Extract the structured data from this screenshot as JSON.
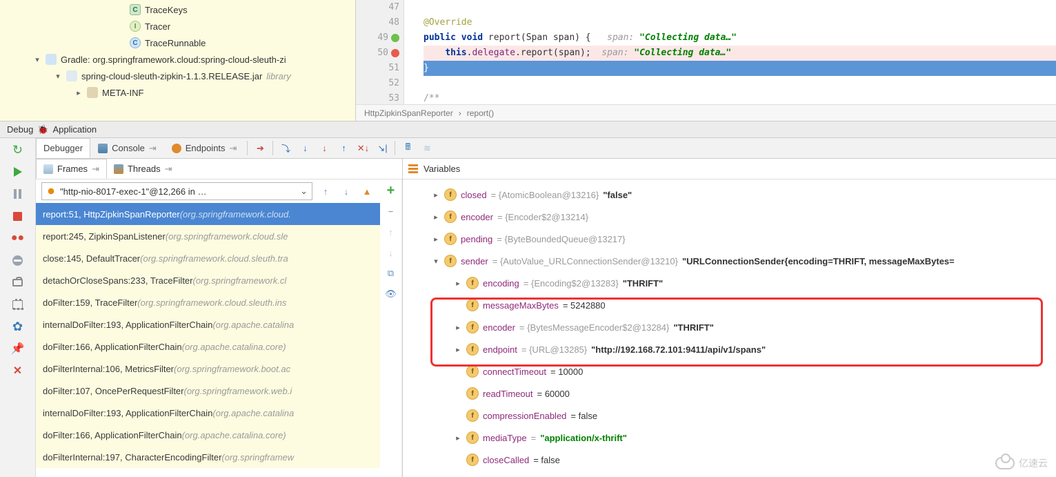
{
  "projectTree": {
    "items": [
      {
        "indent": 170,
        "exp": "",
        "icon": "ico-key",
        "iconChar": "C",
        "label": "TraceKeys"
      },
      {
        "indent": 170,
        "exp": "",
        "icon": "ico-i",
        "iconChar": "I",
        "label": "Tracer"
      },
      {
        "indent": 170,
        "exp": "",
        "icon": "ico-c",
        "iconChar": "C",
        "label": "TraceRunnable"
      },
      {
        "indent": 48,
        "exp": "▾",
        "icon": "ico-gradle",
        "iconChar": "",
        "label": "Gradle: org.springframework.cloud:spring-cloud-sleuth-zi"
      },
      {
        "indent": 78,
        "exp": "▾",
        "icon": "ico-jar",
        "iconChar": "",
        "label": "spring-cloud-sleuth-zipkin-1.1.3.RELEASE.jar",
        "suffix": "library"
      },
      {
        "indent": 108,
        "exp": "▸",
        "icon": "ico-folder",
        "iconChar": "",
        "label": "META-INF"
      }
    ]
  },
  "editor": {
    "lines": [
      {
        "num": "47",
        "gutter": "",
        "segments": []
      },
      {
        "num": "48",
        "gutter": "",
        "segments": [
          {
            "cls": "kw-ann",
            "t": "@Override"
          }
        ]
      },
      {
        "num": "49",
        "gutter": "green",
        "segments": [
          {
            "cls": "kw",
            "t": "public void "
          },
          {
            "cls": "fn",
            "t": "report"
          },
          {
            "cls": "",
            "t": "(Span span) { "
          },
          {
            "cls": "prm",
            "t": "  span: "
          },
          {
            "cls": "str",
            "t": "\"Collecting data…\""
          }
        ]
      },
      {
        "num": "50",
        "gutter": "red",
        "hl": true,
        "segments": [
          {
            "cls": "",
            "t": "    "
          },
          {
            "cls": "kw-this",
            "t": "this"
          },
          {
            "cls": "",
            "t": "."
          },
          {
            "cls": "mem",
            "t": "delegate"
          },
          {
            "cls": "",
            "t": ".report(span);"
          },
          {
            "cls": "prm",
            "t": "  span: "
          },
          {
            "cls": "str",
            "t": "\"Collecting data…\""
          }
        ]
      },
      {
        "num": "51",
        "gutter": "",
        "sel": true,
        "segments": [
          {
            "cls": "",
            "t": "}"
          }
        ]
      },
      {
        "num": "52",
        "gutter": "",
        "segments": []
      },
      {
        "num": "53",
        "gutter": "",
        "segments": [
          {
            "cls": "cmt",
            "t": "/**"
          }
        ]
      }
    ],
    "breadcrumb": [
      "HttpZipkinSpanReporter",
      "report()"
    ]
  },
  "debugBar": {
    "label": "Debug",
    "app": "Application"
  },
  "tabs": {
    "debugger": "Debugger",
    "console": "Console",
    "endpoints": "Endpoints"
  },
  "framesPanel": {
    "frames": "Frames",
    "threads": "Threads",
    "thread": "\"http-nio-8017-exec-1\"@12,266 in …",
    "stack": [
      {
        "sel": true,
        "lib": false,
        "main": "report:51, HttpZipkinSpanReporter ",
        "gray": "(org.springframework.cloud."
      },
      {
        "sel": false,
        "lib": true,
        "main": "report:245, ZipkinSpanListener ",
        "gray": "(org.springframework.cloud.sle"
      },
      {
        "sel": false,
        "lib": true,
        "main": "close:145, DefaultTracer ",
        "gray": "(org.springframework.cloud.sleuth.tra"
      },
      {
        "sel": false,
        "lib": true,
        "main": "detachOrCloseSpans:233, TraceFilter ",
        "gray": "(org.springframework.cl"
      },
      {
        "sel": false,
        "lib": true,
        "main": "doFilter:159, TraceFilter ",
        "gray": "(org.springframework.cloud.sleuth.ins"
      },
      {
        "sel": false,
        "lib": true,
        "main": "internalDoFilter:193, ApplicationFilterChain ",
        "gray": "(org.apache.catalina"
      },
      {
        "sel": false,
        "lib": true,
        "main": "doFilter:166, ApplicationFilterChain ",
        "gray": "(org.apache.catalina.core)"
      },
      {
        "sel": false,
        "lib": true,
        "main": "doFilterInternal:106, MetricsFilter ",
        "gray": "(org.springframework.boot.ac"
      },
      {
        "sel": false,
        "lib": true,
        "main": "doFilter:107, OncePerRequestFilter ",
        "gray": "(org.springframework.web.i"
      },
      {
        "sel": false,
        "lib": true,
        "main": "internalDoFilter:193, ApplicationFilterChain ",
        "gray": "(org.apache.catalina"
      },
      {
        "sel": false,
        "lib": true,
        "main": "doFilter:166, ApplicationFilterChain ",
        "gray": "(org.apache.catalina.core)"
      },
      {
        "sel": false,
        "lib": true,
        "main": "doFilterInternal:197, CharacterEncodingFilter ",
        "gray": "(org.springframew"
      }
    ]
  },
  "varsPanel": {
    "title": "Variables",
    "rows": [
      {
        "indent": 42,
        "exp": "▸",
        "name": "closed",
        "gray": " = {AtomicBoolean@13216} ",
        "val": "\"false\"",
        "valCls": "vf-str"
      },
      {
        "indent": 42,
        "exp": "▸",
        "name": "encoder",
        "gray": " = {Encoder$2@13214}",
        "val": "",
        "valCls": ""
      },
      {
        "indent": 42,
        "exp": "▸",
        "name": "pending",
        "gray": " = {ByteBoundedQueue@13217}",
        "val": "",
        "valCls": ""
      },
      {
        "indent": 42,
        "exp": "▾",
        "name": "sender",
        "gray": " = {AutoValue_URLConnectionSender@13210} ",
        "val": "\"URLConnectionSender{encoding=THRIFT, messageMaxBytes=",
        "valCls": "vf-str"
      },
      {
        "indent": 74,
        "exp": "▸",
        "name": "encoding",
        "gray": " = {Encoding$2@13283} ",
        "val": "\"THRIFT\"",
        "valCls": "vf-str"
      },
      {
        "indent": 74,
        "exp": "",
        "name": "messageMaxBytes",
        "gray": "",
        "val": " = 5242880",
        "valCls": ""
      },
      {
        "indent": 74,
        "exp": "▸",
        "name": "encoder",
        "gray": " = {BytesMessageEncoder$2@13284} ",
        "val": "\"THRIFT\"",
        "valCls": "vf-str"
      },
      {
        "indent": 74,
        "exp": "▸",
        "name": "endpoint",
        "gray": " = {URL@13285} ",
        "val": "\"http://192.168.72.101:9411/api/v1/spans\"",
        "valCls": "vf-str"
      },
      {
        "indent": 74,
        "exp": "",
        "name": "connectTimeout",
        "gray": "",
        "val": " = 10000",
        "valCls": ""
      },
      {
        "indent": 74,
        "exp": "",
        "name": "readTimeout",
        "gray": "",
        "val": " = 60000",
        "valCls": ""
      },
      {
        "indent": 74,
        "exp": "",
        "name": "compressionEnabled",
        "gray": "",
        "val": " = false",
        "valCls": ""
      },
      {
        "indent": 74,
        "exp": "▸",
        "name": "mediaType",
        "gray": " = ",
        "val": "\"application/x-thrift\"",
        "valCls": "vf-green"
      },
      {
        "indent": 74,
        "exp": "",
        "name": "closeCalled",
        "gray": "",
        "val": " = false",
        "valCls": ""
      }
    ]
  },
  "watermark": "亿速云"
}
